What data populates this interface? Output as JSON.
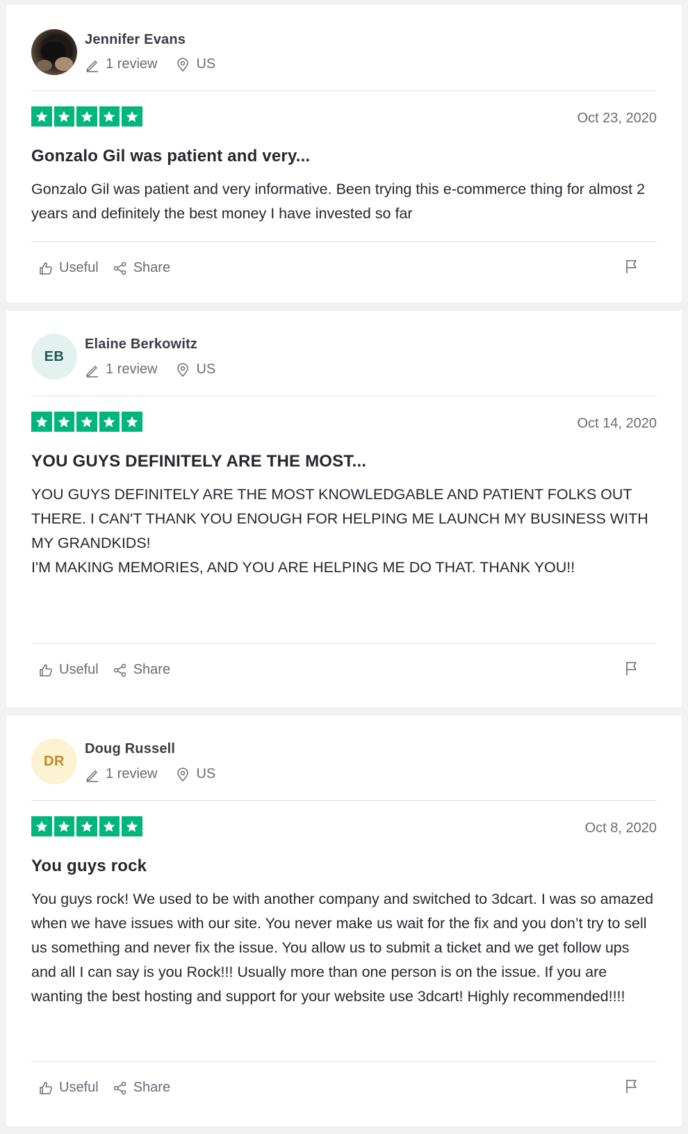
{
  "colors": {
    "star_green": "#00b67a",
    "page_bg": "#f2f2f4",
    "card_bg": "#ffffff",
    "muted_text": "#6b6b76"
  },
  "icons": {
    "review_count": "pencil-icon",
    "location": "location-pin-icon",
    "useful": "thumbs-up-icon",
    "share": "share-icon",
    "report": "flag-icon",
    "star": "star-icon"
  },
  "reviews": [
    {
      "author": "Jennifer Evans",
      "avatar_initials": "",
      "avatar_type": "photo",
      "review_count": "1 review",
      "location": "US",
      "rating": 5,
      "date": "Oct 23, 2020",
      "title": "Gonzalo Gil was patient and very...",
      "body": "Gonzalo Gil was patient and very informative. Been trying this e-commerce thing for almost 2 years and definitely the best money I have invested so far",
      "useful_label": "Useful",
      "share_label": "Share"
    },
    {
      "author": "Elaine Berkowitz",
      "avatar_initials": "EB",
      "avatar_type": "initials",
      "avatar_bg": "#e3f2ef",
      "avatar_fg": "#1f5a55",
      "review_count": "1 review",
      "location": "US",
      "rating": 5,
      "date": "Oct 14, 2020",
      "title": "YOU GUYS DEFINITELY ARE THE MOST...",
      "body": "YOU GUYS DEFINITELY ARE THE MOST KNOWLEDGABLE AND PATIENT FOLKS OUT THERE. I CAN'T THANK YOU ENOUGH FOR HELPING ME LAUNCH MY BUSINESS WITH MY GRANDKIDS!\nI'M MAKING MEMORIES, AND YOU ARE HELPING ME DO THAT. THANK YOU!!",
      "useful_label": "Useful",
      "share_label": "Share"
    },
    {
      "author": "Doug Russell",
      "avatar_initials": "DR",
      "avatar_type": "initials",
      "avatar_bg": "#fbf3d2",
      "avatar_fg": "#c0892b",
      "review_count": "1 review",
      "location": "US",
      "rating": 5,
      "date": "Oct 8, 2020",
      "title": "You guys rock",
      "body": "You guys rock! We used to be with another company and switched to 3dcart. I was so amazed when we have issues with our site. You never make us wait for the fix and you don’t try to sell us something and never fix the issue. You allow us to submit a ticket and we get follow ups and all I can say is you Rock!!! Usually more than one person is on the issue. If you are wanting the best hosting and support for your website use 3dcart! Highly recommended!!!!",
      "useful_label": "Useful",
      "share_label": "Share"
    }
  ]
}
